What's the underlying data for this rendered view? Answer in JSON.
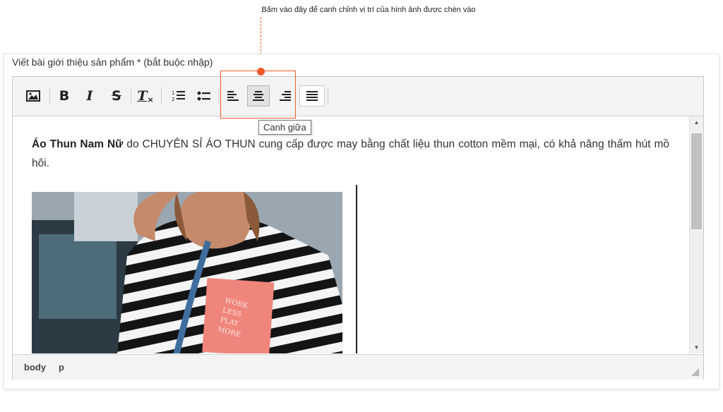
{
  "annotation": {
    "note": "Bấm vào đây để canh chỉnh vị trí của hình ảnh được chèn vào",
    "tooltip": "Canh giữa"
  },
  "field": {
    "label": "Viết bài giới thiệu sản phẩm * (bắt buộc nhập)"
  },
  "toolbar": {
    "buttons": [
      {
        "name": "insert-image",
        "icon": "image-icon"
      },
      {
        "name": "bold",
        "text": "B"
      },
      {
        "name": "italic",
        "text": "I"
      },
      {
        "name": "strikethrough",
        "text": "S"
      },
      {
        "name": "clear-formatting",
        "text": "T"
      },
      {
        "name": "numbered-list",
        "icon": "numbered-list-icon"
      },
      {
        "name": "bulleted-list",
        "icon": "bulleted-list-icon"
      },
      {
        "name": "align-left",
        "icon": "align-left-icon"
      },
      {
        "name": "align-center",
        "icon": "align-center-icon",
        "active": true
      },
      {
        "name": "align-right",
        "icon": "align-right-icon"
      },
      {
        "name": "justify",
        "icon": "justify-icon"
      }
    ]
  },
  "content": {
    "bold_text": "Áo Thun Nam Nữ",
    "body_text": " do CHUYÊN SỈ ÁO THUN cung cấp được may bằng chất liệu thun cotton mềm mại, có khả năng thấm hút mồ hôi.",
    "image_shirt_text": [
      "WORK",
      "LESS",
      "PLAY",
      "MORE"
    ]
  },
  "statusbar": {
    "path": [
      "body",
      "p"
    ]
  },
  "colors": {
    "accent": "#f05a28"
  }
}
